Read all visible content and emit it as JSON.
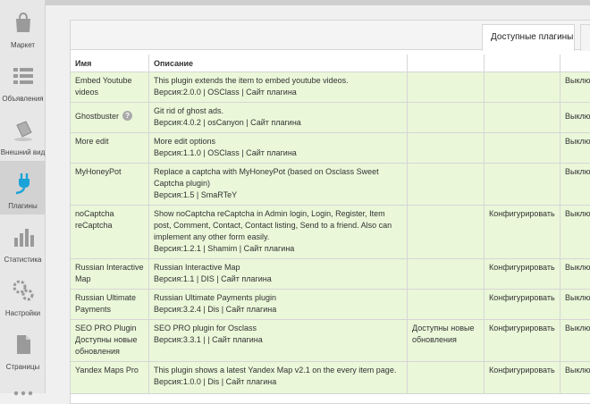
{
  "sidebar": {
    "items": [
      {
        "label": "Маркет",
        "icon": "market-bag-icon"
      },
      {
        "label": "Объявления",
        "icon": "listings-icon"
      },
      {
        "label": "Внешний вид",
        "icon": "paint-bucket-icon"
      },
      {
        "label": "Плагины",
        "icon": "plug-icon"
      },
      {
        "label": "Статистика",
        "icon": "bar-chart-icon"
      },
      {
        "label": "Настройки",
        "icon": "gears-icon"
      },
      {
        "label": "Страницы",
        "icon": "page-icon"
      }
    ],
    "active_color": "#1aa3d8"
  },
  "tabs": {
    "active": "Доступные плагины"
  },
  "table": {
    "headers": {
      "name": "Имя",
      "description": "Описание"
    },
    "rows": [
      {
        "name": "Embed Youtube videos",
        "desc": "This plugin extends the item to embed youtube videos.",
        "meta": "Версия:2.0.0 | OSClass | Сайт плагина",
        "update": "",
        "configure": "",
        "status": "Выклю"
      },
      {
        "name": "Ghostbuster",
        "help": "?",
        "desc": "Git rid of ghost ads.",
        "meta": "Версия:4.0.2 | osCanyon | Сайт плагина",
        "update": "",
        "configure": "",
        "status": "Выклю"
      },
      {
        "name": "More edit",
        "desc": "More edit options",
        "meta": "Версия:1.1.0 | OSClass | Сайт плагина",
        "update": "",
        "configure": "",
        "status": "Выклю"
      },
      {
        "name": "MyHoneyPot",
        "desc": "Replace a captcha with MyHoneyPot (based on Osclass Sweet Captcha plugin)",
        "meta": "Версия:1.5 | SmaRTeY",
        "update": "",
        "configure": "",
        "status": "Выклю"
      },
      {
        "name": "noCaptcha reCaptcha",
        "desc": "Show noCaptcha reCaptcha in Admin login, Login, Register, Item post, Comment, Contact, Contact listing, Send to a friend. Also can implement any other form easily.",
        "meta": "Версия:1.2.1 | Shamim | Сайт плагина",
        "update": "",
        "configure": "Конфигурировать",
        "status": "Выклю"
      },
      {
        "name": "Russian Interactive Map",
        "desc": "Russian Interactive Map",
        "meta": "Версия:1.1 | DIS | Сайт плагина",
        "update": "",
        "configure": "Конфигурировать",
        "status": "Выклю"
      },
      {
        "name": "Russian Ultimate Payments",
        "desc": "Russian Ultimate Payments plugin",
        "meta": "Версия:3.2.4 | Dis | Сайт плагина",
        "update": "",
        "configure": "Конфигурировать",
        "status": "Выклю"
      },
      {
        "name": "SEO PRO Plugin Доступны новые обновления",
        "desc": "SEO PRO plugin for Osclass",
        "meta": "Версия:3.3.1 | | Сайт плагина",
        "update": "Доступны новые обновления",
        "configure": "Конфигурировать",
        "status": "Выклю"
      },
      {
        "name": "Yandex Maps Pro",
        "desc": "This plugin shows a latest Yandex Map v2.1 on the every item page.",
        "meta": "Версия:1.0.0 | Dis | Сайт плагина",
        "update": "",
        "configure": "Конфигурировать",
        "status": "Выклю"
      }
    ]
  }
}
